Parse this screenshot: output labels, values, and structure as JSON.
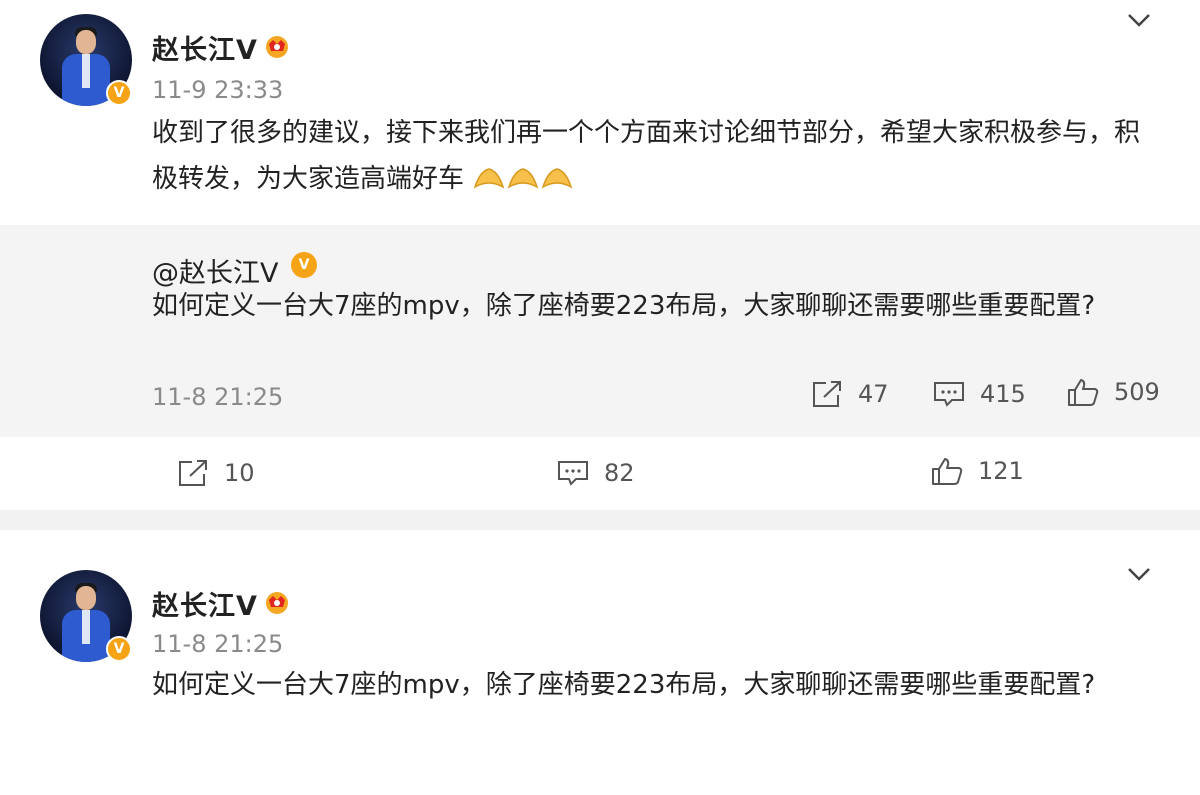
{
  "post1": {
    "author": "赵长江V",
    "time": "11-9 23:33",
    "text": "收到了很多的建议，接下来我们再一个个方面来讨论细节部分，希望大家积极参与，积极转发，为大家造高端好车",
    "repost": {
      "author": "@赵长江V",
      "text": "如何定义一台大7座的mpv，除了座椅要223布局，大家聊聊还需要哪些重要配置?",
      "time": "11-8 21:25",
      "reposts": "47",
      "comments": "415",
      "likes": "509"
    },
    "reposts": "10",
    "comments": "82",
    "likes": "121"
  },
  "post2": {
    "author": "赵长江V",
    "time": "11-8 21:25",
    "text": "如何定义一台大7座的mpv，除了座椅要223布局，大家聊聊还需要哪些重要配置?"
  },
  "badges": {
    "verified": "V"
  },
  "icons": {
    "verified_badge": "orange-v-badge-icon",
    "member": "member-crown-icon",
    "more": "chevron-down-icon",
    "repost": "repost-icon",
    "comment": "comment-icon",
    "like": "like-icon",
    "emoji": "clapping-hands-emoji"
  },
  "colors": {
    "accent": "#f7a316",
    "text": "#222222",
    "muted": "#8a8a8a",
    "repost_bg": "#f4f4f4"
  }
}
